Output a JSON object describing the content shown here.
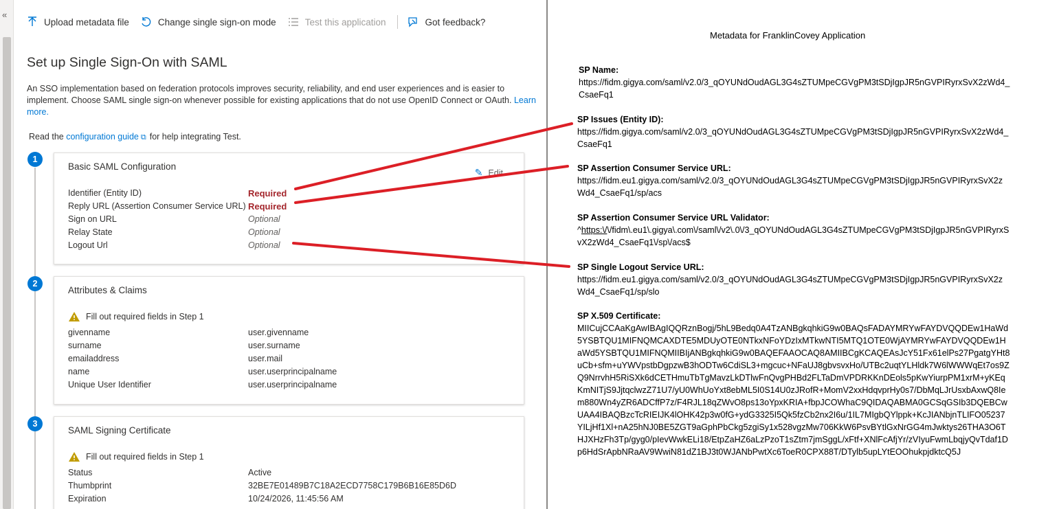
{
  "toolbar": {
    "upload": "Upload metadata file",
    "change_mode": "Change single sign-on mode",
    "test": "Test this application",
    "feedback": "Got feedback?"
  },
  "page": {
    "title": "Set up Single Sign-On with SAML",
    "intro": "An SSO implementation based on federation protocols improves security, reliability, and end user experiences and is easier to implement. Choose SAML single sign-on whenever possible for existing applications that do not use OpenID Connect or OAuth.",
    "learn_more": "Learn more.",
    "guide_prefix": "Read the",
    "guide_link": "configuration guide",
    "guide_suffix": "for help integrating Test."
  },
  "steps": {
    "s1": "1",
    "s2": "2",
    "s3": "3"
  },
  "basic": {
    "title": "Basic SAML Configuration",
    "edit": "Edit",
    "rows": [
      {
        "key": "Identifier (Entity ID)",
        "value": "Required"
      },
      {
        "key": "Reply URL (Assertion Consumer Service URL)",
        "value": "Required"
      },
      {
        "key": "Sign on URL",
        "value": "Optional"
      },
      {
        "key": "Relay State",
        "value": "Optional"
      },
      {
        "key": "Logout Url",
        "value": "Optional"
      }
    ]
  },
  "attributes": {
    "title": "Attributes & Claims",
    "warning": "Fill out required fields in Step 1",
    "rows": [
      {
        "key": "givenname",
        "value": "user.givenname"
      },
      {
        "key": "surname",
        "value": "user.surname"
      },
      {
        "key": "emailaddress",
        "value": "user.mail"
      },
      {
        "key": "name",
        "value": "user.userprincipalname"
      },
      {
        "key": "Unique User Identifier",
        "value": "user.userprincipalname"
      }
    ]
  },
  "certificate": {
    "title": "SAML Signing Certificate",
    "warning": "Fill out required fields in Step 1",
    "rows": [
      {
        "key": "Status",
        "value": "Active"
      },
      {
        "key": "Thumbprint",
        "value": "32BE7E01489B7C18A2ECD7758C179B6B16E85D6D"
      },
      {
        "key": "Expiration",
        "value": "10/24/2026, 11:45:56 AM"
      }
    ]
  },
  "doc": {
    "title": "Metadata for FranklinCovey Application",
    "sp_name_label": "SP Name:",
    "sp_name_value": "https://fidm.gigya.com/saml/v2.0/3_qOYUNdOudAGL3G4sZTUMpeCGVgPM3tSDjIgpJR5nGVPIRyrxSvX2zWd4_CsaeFq1",
    "sp_issues_label": "SP Issues (Entity ID):",
    "sp_issues_value": "https://fidm.gigya.com/saml/v2.0/3_qOYUNdOudAGL3G4sZTUMpeCGVgPM3tSDjIgpJR5nGVPIRyrxSvX2zWd4_CsaeFq1",
    "acs_label": "SP Assertion Consumer Service URL:",
    "acs_value": "https://fidm.eu1.gigya.com/saml/v2.0/3_qOYUNdOudAGL3G4sZTUMpeCGVgPM3tSDjIgpJR5nGVPIRyrxSvX2zWd4_CsaeFq1/sp/acs",
    "acs_validator_label": "SP Assertion Consumer Service URL Validator:",
    "acs_validator_prefix": "^",
    "acs_validator_link": "https:\\/",
    "acs_validator_rest": "\\/fidm\\.eu1\\.gigya\\.com\\/saml\\/v2\\.0\\/3_qOYUNdOudAGL3G4sZTUMpeCGVgPM3tSDjIgpJR5nGVPIRyrxSvX2zWd4_CsaeFq1\\/sp\\/acs$",
    "slo_label": "SP Single Logout Service URL:",
    "slo_value": "https://fidm.eu1.gigya.com/saml/v2.0/3_qOYUNdOudAGL3G4sZTUMpeCGVgPM3tSDjIgpJR5nGVPIRyrxSvX2zWd4_CsaeFq1/sp/slo",
    "cert_label": "SP X.509 Certificate:",
    "cert_value": "MIICujCCAaKgAwIBAgIQQRznBogj/5hL9Bedq0A4TzANBgkqhkiG9w0BAQsFADAYMRYwFAYDVQQDEw1HaWd5YSBTQU1MIFNQMCAXDTE5MDUyOTE0NTkxNFoYDzIxMTkwNTI5MTQ1OTE0WjAYMRYwFAYDVQQDEw1HaWd5YSBTQU1MIFNQMIIBIjANBgkqhkiG9w0BAQEFAAOCAQ8AMIIBCgKCAQEAsJcY51Fx61elPs27PgatgYHt8uCb+sfm+uYWVpstbDgpzwB3hODTw6CdiSL3+mgcuc+NFaUJ8gbvsvxHo/UTBc2uqtYLHldk7W6lWWWqEt7os9ZQ9NrrvhH5RiSXk6dCETHmuTbTgMavzLkDTlwFnQvgPHBd2FLTaDmVPDRKKnDEols5pKwYiurpPM1xrM+yKEqKmNITjS9JjtqclwzZ71U7/yU0WhUoYxt8ebML5I0S14U0zJRofR+MomV2xxHdqvprHy0s7/DbMqLJrUsxbAxwQ8Iem880Wn4yZR6ADCffP7z/F4RJL18qZWvO8ps13oYpxKRIA+fbpJCOWhaC9QIDAQABMA0GCSqGSIb3DQEBCwUAA4IBAQBzcTcRIEIJK4lOHK42p3w0fG+ydG3325I5Qk5fzCb2nx2I6u/1IL7MIgbQYlppk+KcJIANbjnTLIFO05237YILjHf1Xl+nA25hNJ0BE5ZGT9aGphPbCkg5zgiSy1x528vgzMw706KkW6PsvBYtlGxNrGG4mJwktys26THA3O6THJXHzFh3Tp/gyg0/pIevWwkELi18/EtpZaHZ6aLzPzoT1sZtm7jmSggL/xFtf+XNlFcAfjYr/zVIyuFwmLbqjyQvTdaf1Dp6HdSrApbNRaAV9WwiN81dZ1BJ3t0WJANbPwtXc6ToeR0CPX88T/DTylb5upLYtEOOhukpjdktcQ5J"
  },
  "colors": {
    "accent": "#0078d4",
    "required": "#a4262c",
    "arrow": "#dc1f26",
    "warning": "#c19c00"
  }
}
